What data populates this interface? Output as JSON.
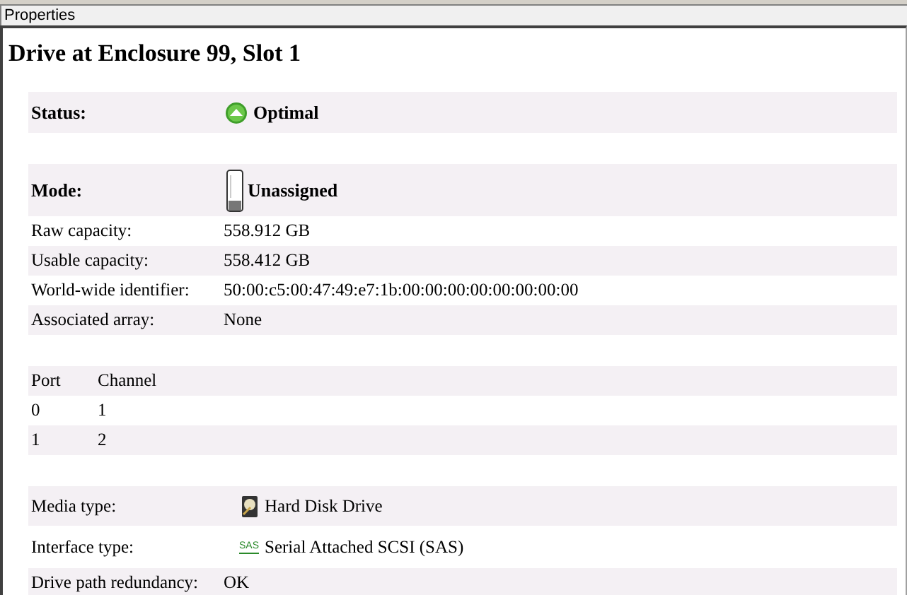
{
  "panel": {
    "title": "Properties"
  },
  "heading": "Drive at Enclosure 99, Slot 1",
  "rows": [
    {
      "kind": "status",
      "label": "Status:",
      "value": "Optimal"
    },
    {
      "kind": "blank"
    },
    {
      "kind": "mode",
      "label": "Mode:",
      "value": "Unassigned"
    },
    {
      "kind": "field",
      "label": "Raw capacity:",
      "value": "558.912 GB"
    },
    {
      "kind": "field",
      "label": "Usable capacity:",
      "value": "558.412 GB"
    },
    {
      "kind": "field",
      "label": "World-wide identifier:",
      "value": "50:00:c5:00:47:49:e7:1b:00:00:00:00:00:00:00:00"
    },
    {
      "kind": "field",
      "label": "Associated array:",
      "value": "None"
    },
    {
      "kind": "blank"
    },
    {
      "kind": "pair",
      "cells": [
        "Port",
        "Channel"
      ]
    },
    {
      "kind": "pair",
      "cells": [
        "0",
        "1"
      ]
    },
    {
      "kind": "pair",
      "cells": [
        "1",
        "2"
      ]
    },
    {
      "kind": "blank"
    },
    {
      "kind": "media",
      "label": "Media type:",
      "value": "Hard Disk Drive"
    },
    {
      "kind": "interface",
      "label": "Interface type:",
      "badge": "SAS",
      "value": "Serial Attached SCSI (SAS)"
    },
    {
      "kind": "field",
      "label": "Drive path redundancy:",
      "value": "OK"
    }
  ]
}
